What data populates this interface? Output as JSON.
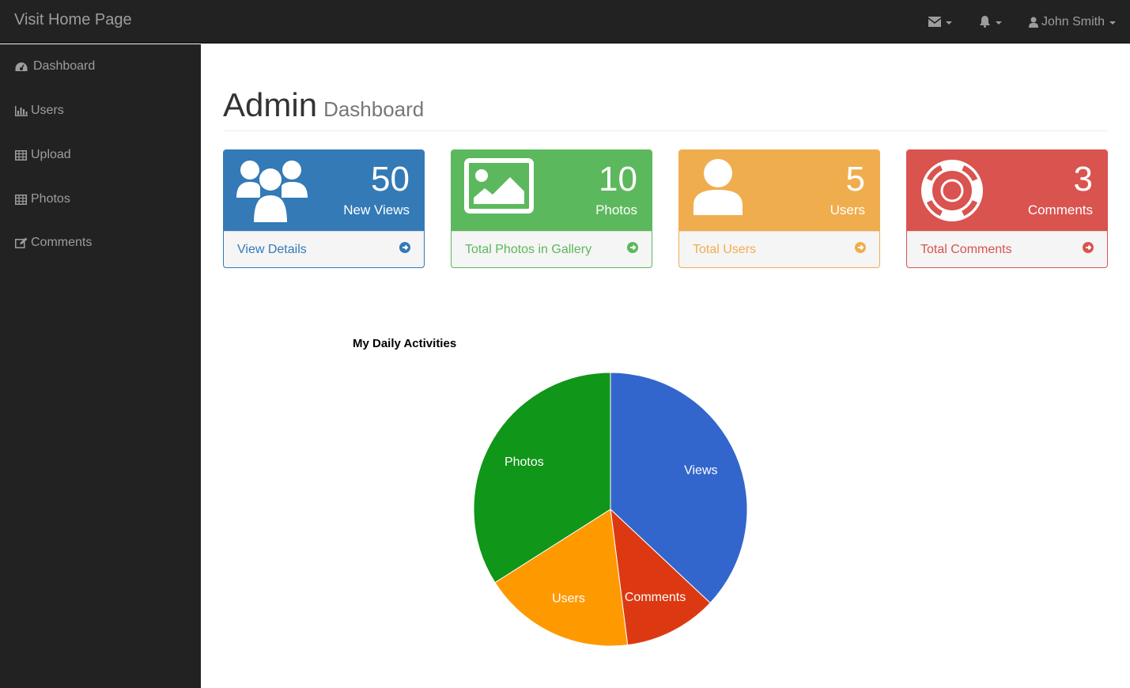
{
  "navbar": {
    "brand": "Visit Home Page",
    "messages_icon": "envelope-icon",
    "alerts_icon": "bell-icon",
    "user_icon": "user-icon",
    "user_name": "John Smith"
  },
  "sidebar": {
    "items": [
      {
        "label": "Dashboard",
        "icon": "dashboard-icon"
      },
      {
        "label": "Users",
        "icon": "bar-chart-icon"
      },
      {
        "label": "Upload",
        "icon": "table-icon"
      },
      {
        "label": "Photos",
        "icon": "table-icon"
      },
      {
        "label": "Comments",
        "icon": "edit-icon"
      }
    ]
  },
  "header": {
    "title": "Admin",
    "subtitle": "Dashboard"
  },
  "panels": [
    {
      "value": "50",
      "label": "New Views",
      "link": "View Details",
      "icon": "users-icon",
      "color": "#337ab7"
    },
    {
      "value": "10",
      "label": "Photos",
      "link": "Total Photos in Gallery",
      "icon": "image-icon",
      "color": "#5cb85c"
    },
    {
      "value": "5",
      "label": "Users",
      "link": "Total Users",
      "icon": "user-icon",
      "color": "#f0ad4e"
    },
    {
      "value": "3",
      "label": "Comments",
      "link": "Total Comments",
      "icon": "life-ring-icon",
      "color": "#d9534f"
    }
  ],
  "chart_data": {
    "type": "pie",
    "title": "My Daily Activities",
    "categories": [
      "Views",
      "Comments",
      "Users",
      "Photos"
    ],
    "values": [
      37,
      11,
      18,
      34
    ],
    "colors": [
      "#3366cc",
      "#dc3912",
      "#ff9900",
      "#109618"
    ]
  }
}
